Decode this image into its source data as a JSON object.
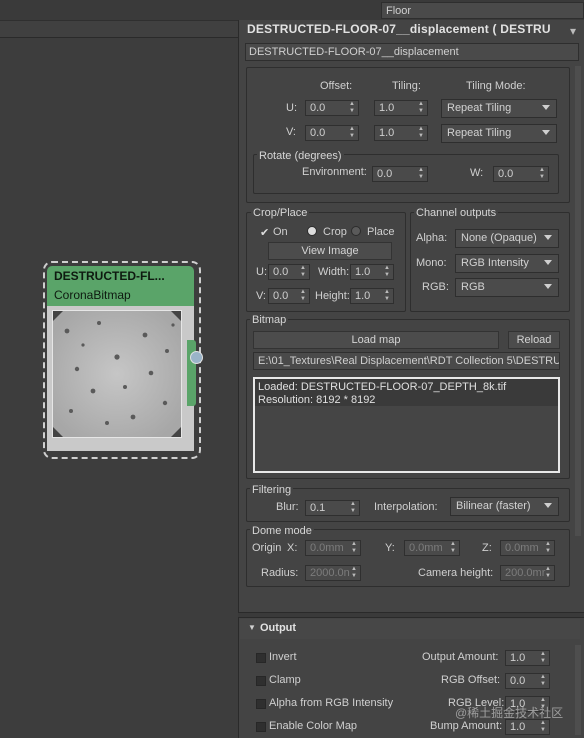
{
  "top_right_field": "Floor",
  "panel": {
    "title": "DESTRUCTED-FLOOR-07__displacement ( DESTRU",
    "name_field": "DESTRUCTED-FLOOR-07__displacement"
  },
  "coords": {
    "offset_header": "Offset:",
    "tiling_header": "Tiling:",
    "tiling_mode_header": "Tiling Mode:",
    "u_label": "U:",
    "v_label": "V:",
    "u_offset": "0.0",
    "u_tiling": "1.0",
    "u_mode": "Repeat Tiling",
    "v_offset": "0.0",
    "v_tiling": "1.0",
    "v_mode": "Repeat Tiling",
    "rotate_title": "Rotate (degrees)",
    "environment_label": "Environment:",
    "environment_value": "0.0",
    "w_label": "W:",
    "w_value": "0.0"
  },
  "crop": {
    "title": "Crop/Place",
    "on_label": "On",
    "crop_label": "Crop",
    "place_label": "Place",
    "view_image": "View Image",
    "u_label": "U:",
    "u_value": "0.0",
    "width_label": "Width:",
    "width_value": "1.0",
    "v_label": "V:",
    "v_value": "0.0",
    "height_label": "Height:",
    "height_value": "1.0"
  },
  "channels": {
    "title": "Channel outputs",
    "alpha_label": "Alpha:",
    "alpha_value": "None (Opaque)",
    "mono_label": "Mono:",
    "mono_value": "RGB Intensity",
    "rgb_label": "RGB:",
    "rgb_value": "RGB"
  },
  "bitmap": {
    "title": "Bitmap",
    "load_map": "Load map",
    "reload": "Reload",
    "path": "E:\\01_Textures\\Real Displacement\\RDT Collection 5\\DESTRUCT",
    "info_line1": "Loaded: DESTRUCTED-FLOOR-07_DEPTH_8k.tif",
    "info_line2": "Resolution: 8192 * 8192"
  },
  "filtering": {
    "title": "Filtering",
    "blur_label": "Blur:",
    "blur_value": "0.1",
    "interp_label": "Interpolation:",
    "interp_value": "Bilinear (faster)"
  },
  "dome": {
    "title": "Dome mode",
    "origin_label": "Origin",
    "x_label": "X:",
    "x_value": "0.0mm",
    "y_label": "Y:",
    "y_value": "0.0mm",
    "z_label": "Z:",
    "z_value": "0.0mm",
    "radius_label": "Radius:",
    "radius_value": "2000.0n",
    "cam_label": "Camera height:",
    "cam_value": "200.0mr"
  },
  "output": {
    "title": "Output",
    "invert": "Invert",
    "clamp": "Clamp",
    "alpha_from_rgb": "Alpha from RGB Intensity",
    "enable_color_map": "Enable Color Map",
    "output_amount_label": "Output Amount:",
    "output_amount_value": "1.0",
    "rgb_offset_label": "RGB Offset:",
    "rgb_offset_value": "0.0",
    "rgb_level_label": "RGB Level:",
    "rgb_level_value": "1.0",
    "bump_amount_label": "Bump Amount:",
    "bump_amount_value": "1.0"
  },
  "node": {
    "title": "DESTRUCTED-FL...",
    "subtitle": "CoronaBitmap"
  },
  "watermark": "@稀土掘金技术社区",
  "colors": {
    "node_header": "#5aa469",
    "panel_bg": "#444444",
    "viewport_bg": "#3d3d3d",
    "selection_bg": "#3a3a3a"
  }
}
